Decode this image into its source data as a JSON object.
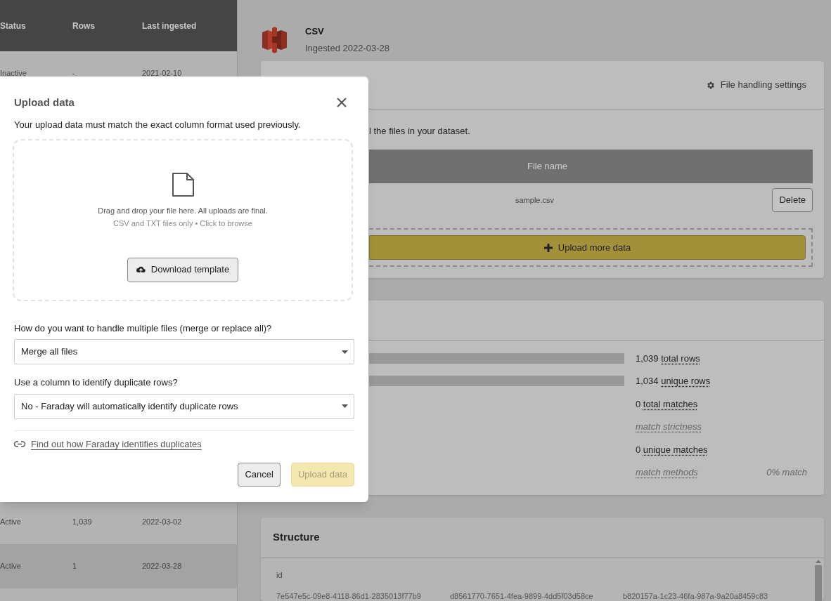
{
  "datasets_table": {
    "columns": [
      "Status",
      "Rows",
      "Last ingested"
    ],
    "rows": [
      {
        "status": "Inactive",
        "rows": "-",
        "last_ingested": "2021-02-10",
        "selected": false
      },
      {
        "status": "Active",
        "rows": "1,039",
        "last_ingested": "2022-03-02",
        "selected": false
      },
      {
        "status": "Active",
        "rows": "1",
        "last_ingested": "2022-03-28",
        "selected": true
      }
    ]
  },
  "dataset": {
    "title": "CSV",
    "subtitle": "Ingested 2022-03-28"
  },
  "files_card": {
    "settings_link": "File handling settings",
    "description": "l the files in your dataset.",
    "column": "File name",
    "files": [
      {
        "name": "sample.csv",
        "action": "Delete"
      }
    ],
    "upload_button": "Upload more data"
  },
  "stats_card": {
    "stats": [
      {
        "kind": "count",
        "number": "1,039",
        "label": "total rows",
        "bar": true
      },
      {
        "kind": "count",
        "number": "1,034",
        "label": "unique rows",
        "bar": true
      },
      {
        "kind": "count",
        "number": "0",
        "label": "total matches"
      },
      {
        "kind": "muted",
        "label": "match strictness"
      },
      {
        "kind": "count",
        "number": "0",
        "label": "unique matches"
      },
      {
        "kind": "muted",
        "label": "match methods",
        "note": "0% match"
      }
    ]
  },
  "structure_card": {
    "title": "Structure",
    "column": "id",
    "values": [
      "7e547e5c-09e8-4118-86d1-2835013f77b9",
      "d8561770-7651-4fea-9899-4dd5f03d58ce",
      "b820157a-1c23-46fa-987a-9a20a8459c83"
    ]
  },
  "modal": {
    "title": "Upload data",
    "description": "Your upload data must match the exact column format used previously.",
    "dropzone": {
      "text": "Drag and drop your file here. All uploads are final.",
      "hint": "CSV and TXT files only • Click to browse",
      "button": "Download template"
    },
    "fields": [
      {
        "label": "How do you want to handle multiple files (merge or replace all)?",
        "value": "Merge all files"
      },
      {
        "label": "Use a column to identify duplicate rows?",
        "value": "No - Faraday will automatically identify duplicate rows"
      }
    ],
    "help_link": "Find out how Faraday identifies duplicates",
    "buttons": [
      {
        "label": "Cancel",
        "disabled": false
      },
      {
        "label": "Upload data",
        "disabled": true
      }
    ]
  }
}
